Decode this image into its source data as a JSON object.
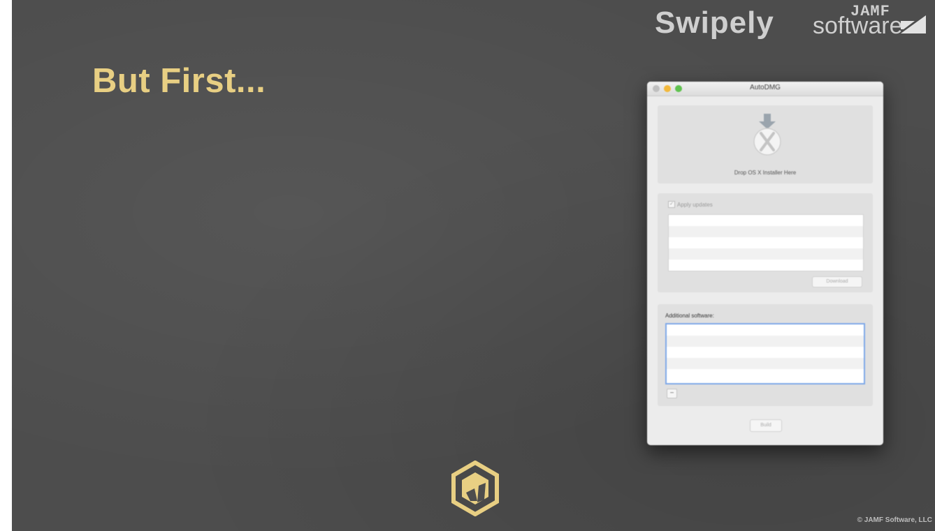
{
  "slide": {
    "title": "But First...",
    "brand_swipely": "Swipely",
    "brand_jamf_top": "JAMF",
    "brand_jamf_bottom": "software",
    "copyright": "© JAMF Software, LLC",
    "accent_color": "#e8cf83"
  },
  "window": {
    "title": "AutoDMG",
    "drop_label": "Drop OS X Installer Here",
    "apply_updates_label": "Apply updates",
    "apply_updates_checked": true,
    "download_label": "Download",
    "additional_software_label": "Additional software:",
    "remove_label": "−",
    "build_label": "Build"
  }
}
